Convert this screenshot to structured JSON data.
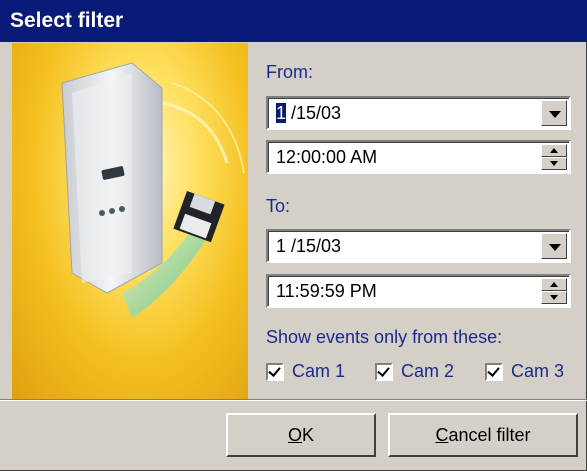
{
  "window": {
    "title": "Select filter"
  },
  "from": {
    "label": "From:",
    "date_selected_part": "1",
    "date_rest": " /15/03",
    "time": "12:00:00 AM"
  },
  "to": {
    "label": "To:",
    "date": "1 /15/03",
    "time": "11:59:59 PM"
  },
  "events": {
    "label": "Show events only from these:",
    "cameras": [
      {
        "label": "Cam 1",
        "checked": true
      },
      {
        "label": "Cam 2",
        "checked": true
      },
      {
        "label": "Cam 3",
        "checked": true
      }
    ]
  },
  "buttons": {
    "ok": {
      "mnemonic": "O",
      "rest": "K"
    },
    "cancel": {
      "mnemonic": "C",
      "rest": "ancel filter"
    }
  },
  "colors": {
    "titlebar": "#0a1a78",
    "label_text": "#1a2a8c",
    "dialog_bg": "#d4d0c8",
    "picture_bg": "#f4c020"
  },
  "icons": {
    "picture": "motion-sensor-with-floppy-disk-illustration"
  }
}
